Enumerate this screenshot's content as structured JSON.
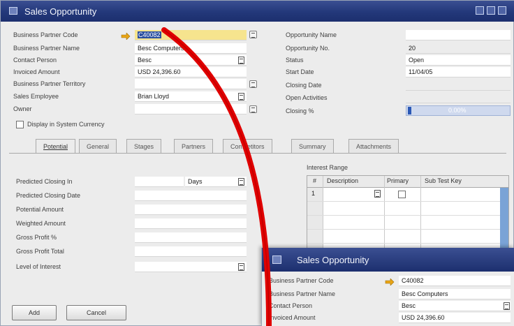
{
  "window": {
    "title": "Sales Opportunity"
  },
  "header_left": [
    {
      "label": "Business Partner Code",
      "value": "C40082"
    },
    {
      "label": "Business Partner Name",
      "value": "Besc Computers"
    },
    {
      "label": "Contact Person",
      "value": "Besc"
    },
    {
      "label": "Invoiced Amount",
      "value": "USD 24,396.60"
    },
    {
      "label": "Business Partner Territory",
      "value": ""
    },
    {
      "label": "Sales Employee",
      "value": "Brian Lloyd"
    },
    {
      "label": "Owner",
      "value": ""
    }
  ],
  "header_right": [
    {
      "label": "Opportunity Name",
      "value": ""
    },
    {
      "label": "Opportunity No.",
      "value": "20"
    },
    {
      "label": "Status",
      "value": "Open"
    },
    {
      "label": "Start Date",
      "value": "11/04/05"
    },
    {
      "label": "Closing Date",
      "value": ""
    },
    {
      "label": "Open Activities",
      "value": ""
    },
    {
      "label": "Closing %",
      "value": "0.00%",
      "progress": 0.0
    }
  ],
  "system_currency_label": "Display in System Currency",
  "tabs": [
    "Potential",
    "General",
    "Stages",
    "Partners",
    "Competitors",
    "Summary",
    "Attachments"
  ],
  "potential": {
    "fields": [
      {
        "label": "Predicted Closing In",
        "value": "",
        "unit": "Days"
      },
      {
        "label": "Predicted Closing Date",
        "value": ""
      },
      {
        "label": "Potential Amount",
        "value": ""
      },
      {
        "label": "Weighted Amount",
        "value": ""
      },
      {
        "label": "Gross Profit %",
        "value": ""
      },
      {
        "label": "Gross Profit Total",
        "value": ""
      },
      {
        "label": "Level of Interest",
        "value": ""
      }
    ],
    "interest_range": {
      "title": "Interest Range",
      "columns": [
        "#",
        "Description",
        "Primary",
        "Sub Test Key"
      ],
      "rows": [
        {
          "num": "1",
          "description": "",
          "primary": false,
          "sub_test_key": ""
        }
      ]
    }
  },
  "buttons": {
    "add": "Add",
    "cancel": "Cancel"
  },
  "overlay": {
    "title": "Sales Opportunity",
    "fields": [
      {
        "label": "Business Partner Code",
        "value": "C40082"
      },
      {
        "label": "Business Partner Name",
        "value": "Besc Computers"
      },
      {
        "label": "Contact Person",
        "value": "Besc"
      },
      {
        "label": "Invoiced Amount",
        "value": "USD 24,396.60"
      }
    ]
  },
  "colors": {
    "titlebar": "#23387a",
    "highlight_field": "#f6e48e",
    "annotation_curve": "#e00000"
  }
}
